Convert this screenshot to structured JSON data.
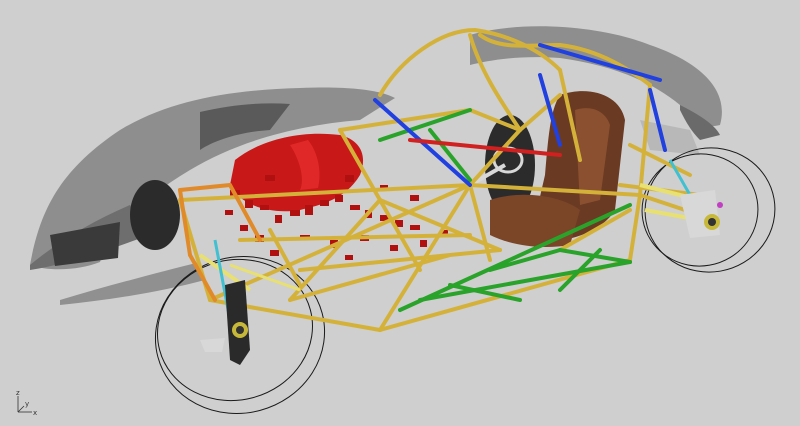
{
  "window": {
    "background": "#cfcfcf"
  },
  "model": {
    "colors": {
      "body_shell": "#8f8f8f",
      "body_shell_dark": "#5a5a5a",
      "frame_main": "#d4b23a",
      "frame_orange": "#e08a2a",
      "frame_green": "#2aa32a",
      "frame_blue": "#2040e0",
      "frame_red": "#d02020",
      "engine": "#c81818",
      "seat": "#6b3a22",
      "suspension": "#e8e070",
      "cyan_link": "#40c0d0",
      "wheel_outline": "#1a1a1a",
      "upright_dark": "#2a2a2a",
      "steering": "#d8d8d8"
    },
    "icons": [
      "coordinate-triad-icon"
    ]
  },
  "triad": {
    "x_label": "x",
    "y_label": "y",
    "z_label": "z"
  }
}
